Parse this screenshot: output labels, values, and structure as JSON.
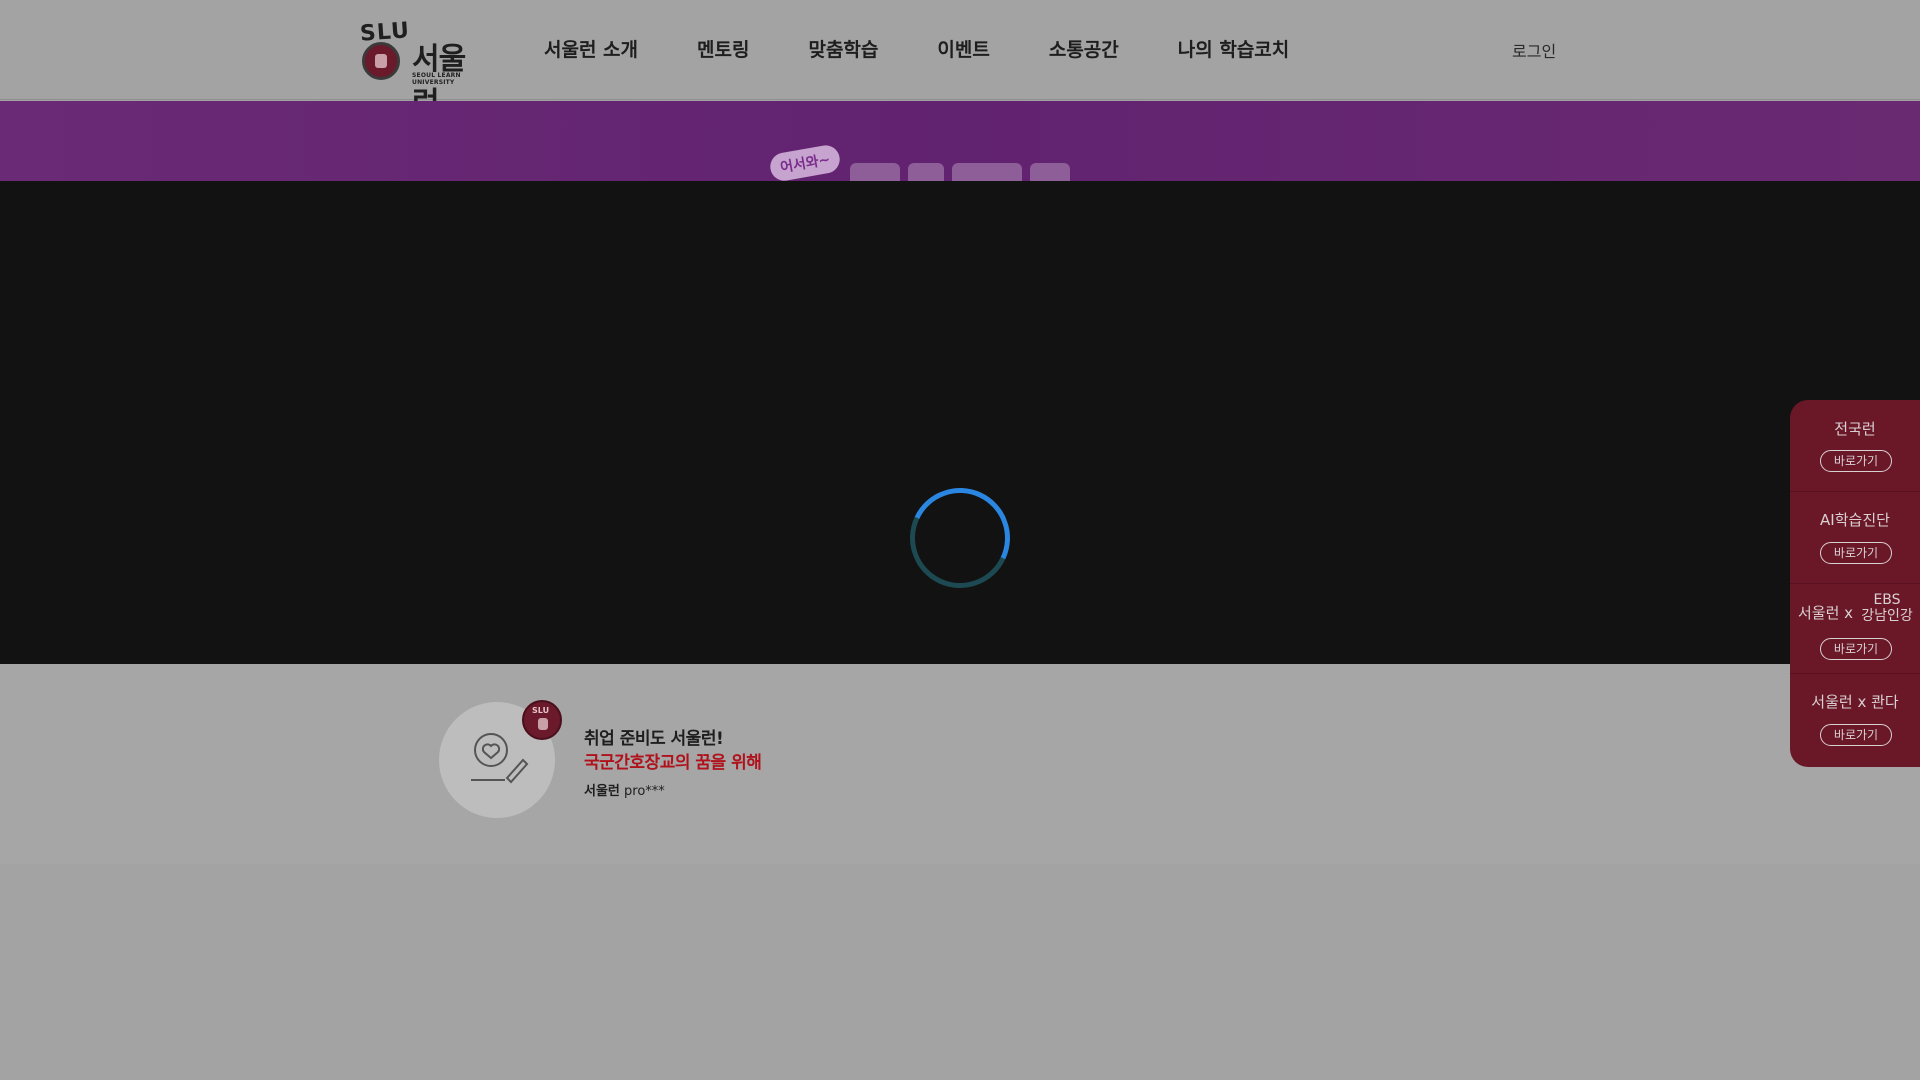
{
  "header": {
    "logo": {
      "slu": "SLU",
      "name": "서울런",
      "subtitle": "SEOUL LEARN UNIVERSITY"
    },
    "nav": [
      {
        "label": "서울런 소개"
      },
      {
        "label": "멘토링"
      },
      {
        "label": "맞춤학습"
      },
      {
        "label": "이벤트"
      },
      {
        "label": "소통공간"
      },
      {
        "label": "나의 학습코치"
      }
    ],
    "login_label": "로그인"
  },
  "banner": {
    "badge": "어서와~"
  },
  "video": {
    "state": "loading"
  },
  "reviews": [
    {
      "title": "취업 준비도 서울런!",
      "subtitle": "국군간호장교의 꿈을 위해",
      "author_brand": "서울런",
      "author_name": "pro***"
    }
  ],
  "quick_menu": {
    "items": [
      {
        "label": "전국런",
        "button": "바로가기"
      },
      {
        "label": "AI학습진단",
        "button": "바로가기"
      },
      {
        "label_left": "서울런 x",
        "label_ebs": "EBS",
        "label_right": "강남인강",
        "button": "바로가기"
      },
      {
        "label": "서울런 x 콴다",
        "button": "바로가기"
      }
    ]
  },
  "colors": {
    "dim_background": "#a3a3a3",
    "banner_purple": "#612270",
    "video_overlay": "#121212",
    "spinner_accent": "#2a86e0",
    "quick_menu_bg": "#6a1828",
    "review_highlight": "#b0121c"
  }
}
